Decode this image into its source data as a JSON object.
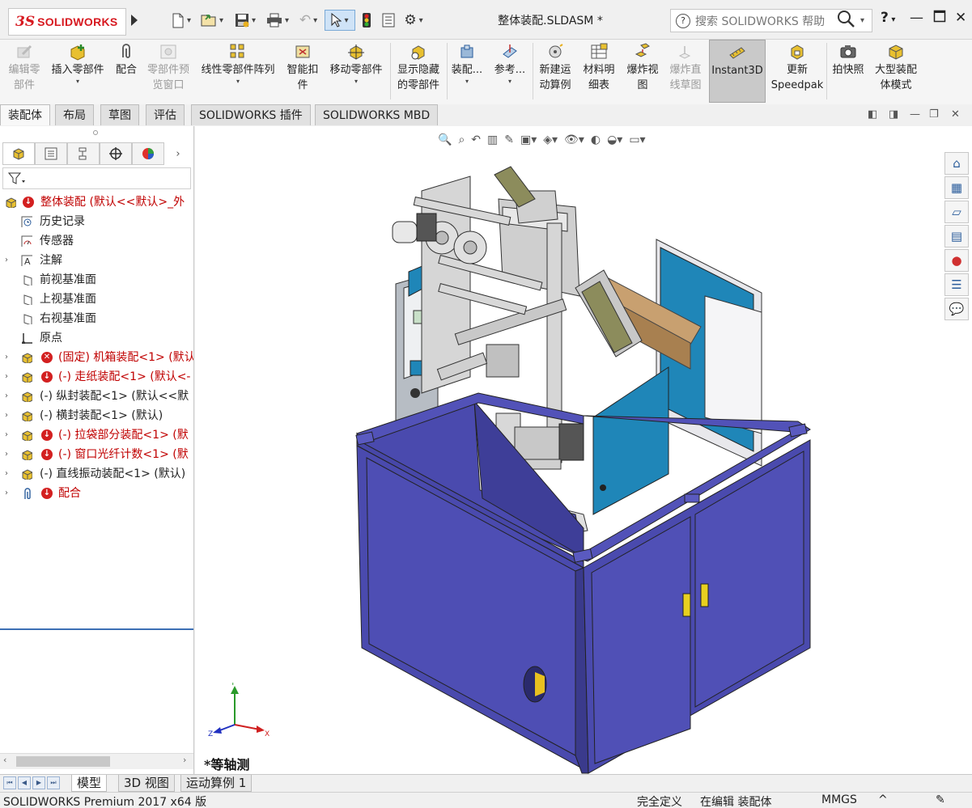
{
  "app": {
    "logo_ds": "3S",
    "logo_text": "SOLIDWORKS",
    "document_title": "整体装配.SLDASM *",
    "help_search_placeholder": "搜索 SOLIDWORKS 帮助",
    "help_label": "?"
  },
  "ribbon": {
    "buttons": [
      {
        "label": "编辑零部件",
        "line1": "编辑零",
        "line2": "部件",
        "disabled": true
      },
      {
        "label": "插入零部件",
        "line1": "插入零部件",
        "line2": "",
        "disabled": false
      },
      {
        "label": "配合",
        "line1": "配合",
        "line2": "",
        "disabled": false
      },
      {
        "label": "零部件预览窗口",
        "line1": "零部件预",
        "line2": "览窗口",
        "disabled": true
      },
      {
        "label": "线性零部件阵列",
        "line1": "线性零部件阵列",
        "line2": "",
        "disabled": false
      },
      {
        "label": "智能扣件",
        "line1": "智能扣",
        "line2": "件",
        "disabled": false
      },
      {
        "label": "移动零部件",
        "line1": "移动零部件",
        "line2": "",
        "disabled": false
      },
      {
        "label": "显示隐藏的零部件",
        "line1": "显示隐藏",
        "line2": "的零部件",
        "disabled": false
      },
      {
        "label": "装配...",
        "line1": "装配...",
        "line2": "",
        "disabled": false
      },
      {
        "label": "参考...",
        "line1": "参考...",
        "line2": "",
        "disabled": false
      },
      {
        "label": "新建运动算例",
        "line1": "新建运",
        "line2": "动算例",
        "disabled": false
      },
      {
        "label": "材料明细表",
        "line1": "材料明",
        "line2": "细表",
        "disabled": false
      },
      {
        "label": "爆炸视图",
        "line1": "爆炸视",
        "line2": "图",
        "disabled": false
      },
      {
        "label": "爆炸直线草图",
        "line1": "爆炸直",
        "line2": "线草图",
        "disabled": true
      },
      {
        "label": "Instant3D",
        "line1": "Instant3D",
        "line2": "",
        "disabled": false
      },
      {
        "label": "更新Speedpak",
        "line1": "更新",
        "line2": "Speedpak",
        "disabled": false
      },
      {
        "label": "拍快照",
        "line1": "拍快照",
        "line2": "",
        "disabled": false
      },
      {
        "label": "大型装配体模式",
        "line1": "大型装配",
        "line2": "体模式",
        "disabled": false
      }
    ]
  },
  "command_tabs": [
    "装配体",
    "布局",
    "草图",
    "评估",
    "SOLIDWORKS 插件",
    "SOLIDWORKS MBD"
  ],
  "feature_tree": {
    "root": "整体装配  (默认<<默认>_外",
    "items": [
      {
        "label": "历史记录",
        "icon": "history-icon",
        "status": "normal"
      },
      {
        "label": "传感器",
        "icon": "sensor-icon",
        "status": "normal"
      },
      {
        "label": "注解",
        "icon": "annotation-icon",
        "status": "normal"
      },
      {
        "label": "前视基准面",
        "icon": "plane-icon",
        "status": "normal"
      },
      {
        "label": "上视基准面",
        "icon": "plane-icon",
        "status": "normal"
      },
      {
        "label": "右视基准面",
        "icon": "plane-icon",
        "status": "normal"
      },
      {
        "label": "原点",
        "icon": "origin-icon",
        "status": "normal"
      },
      {
        "label": "(固定) 机箱装配<1> (默认",
        "icon": "subassembly-icon",
        "status": "error"
      },
      {
        "label": "(-) 走纸装配<1> (默认<-",
        "icon": "subassembly-icon",
        "status": "warning"
      },
      {
        "label": "(-) 纵封装配<1> (默认<<默",
        "icon": "subassembly-icon",
        "status": "normal"
      },
      {
        "label": "(-) 横封装配<1> (默认)",
        "icon": "subassembly-icon",
        "status": "normal"
      },
      {
        "label": "(-) 拉袋部分装配<1> (默",
        "icon": "subassembly-icon",
        "status": "warning"
      },
      {
        "label": "(-) 窗口光纤计数<1> (默",
        "icon": "subassembly-icon",
        "status": "warning"
      },
      {
        "label": "(-) 直线振动装配<1> (默认)",
        "icon": "subassembly-icon",
        "status": "normal"
      },
      {
        "label": "配合",
        "icon": "mates-icon",
        "status": "warning"
      }
    ]
  },
  "viewport": {
    "view_label": "*等轴测",
    "triad": {
      "x": "X",
      "y": "Y",
      "z": "Z"
    }
  },
  "bottom_tabs": [
    "模型",
    "3D 视图",
    "运动算例 1"
  ],
  "status_bar": {
    "product": "SOLIDWORKS Premium 2017 x64 版",
    "definition": "完全定义",
    "mode": "在编辑 装配体",
    "units": "MMGS",
    "caret": "^"
  },
  "colors": {
    "cabinet": "#4a4aae",
    "cabinet_dark": "#3a3a8c",
    "door_teal": "#1f86b8",
    "error_red": "#d32020",
    "tree_selection": "#3c6fb4"
  }
}
